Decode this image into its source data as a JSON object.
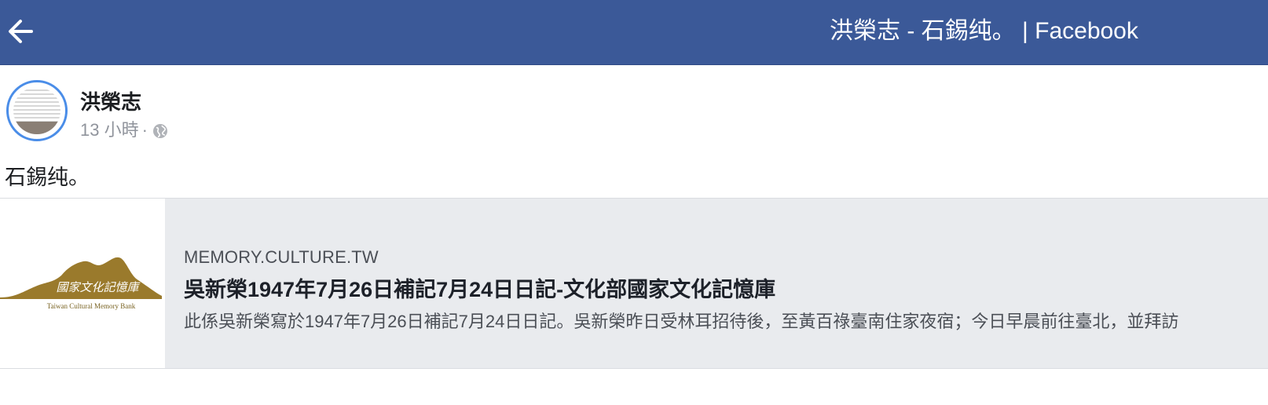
{
  "header": {
    "title": "洪榮志 - 石錫纯。 | Facebook",
    "background_color": "#3b5998",
    "back_icon": "arrow-left-icon"
  },
  "post": {
    "author": "洪榮志",
    "time": "13 小時",
    "separator": "·",
    "privacy_icon": "globe-icon",
    "avatar_ring_color": "#4a8de8",
    "text": "石錫纯。",
    "link": {
      "thumbnail_caption_zh": "國家文化記憶庫",
      "thumbnail_caption_en": "Taiwan Cultural Memory Bank",
      "domain": "MEMORY.CULTURE.TW",
      "title": "吳新榮1947年7月26日補記7月24日日記-文化部國家文化記憶庫",
      "description": "此係吳新榮寫於1947年7月26日補記7月24日日記。吳新榮昨日受林耳招待後，至黃百祿臺南住家夜宿；今日早晨前往臺北，並拜訪"
    }
  }
}
